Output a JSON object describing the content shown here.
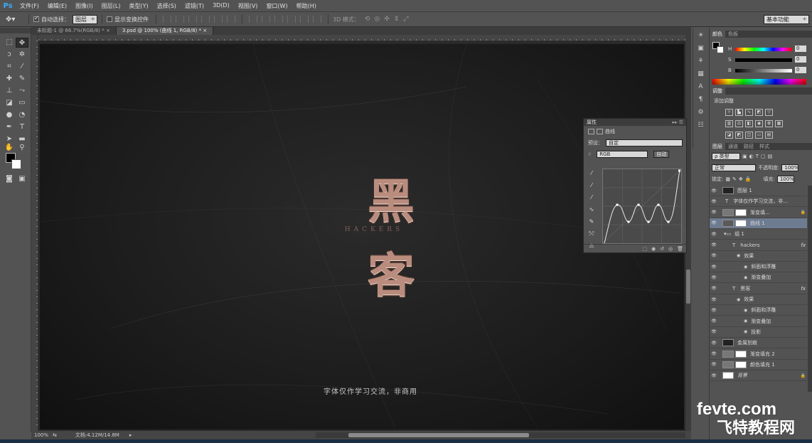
{
  "app": {
    "logo": "Ps"
  },
  "menu": [
    "文件(F)",
    "编辑(E)",
    "图像(I)",
    "图层(L)",
    "类型(Y)",
    "选择(S)",
    "滤镜(T)",
    "3D(D)",
    "视图(V)",
    "窗口(W)",
    "帮助(H)"
  ],
  "options_bar": {
    "auto_select_label": "自动选择：",
    "auto_select_value": "图层",
    "show_transform_label": "显示变换控件",
    "mode_3d_label": "3D 模式：",
    "workspace": "基本功能"
  },
  "doc_tabs": [
    {
      "label": "未标题-1 @ 66.7%(RGB/8) *",
      "active": false
    },
    {
      "label": "3.psd @ 100% (曲线 1, RGB/8) *",
      "active": true
    }
  ],
  "artwork": {
    "char1": "黑",
    "subtitle": "HACKERS",
    "char2": "客",
    "caption": "字体仅作学习交流，非商用"
  },
  "status_bar": {
    "zoom": "100%",
    "doc_size": "文档:4.12M/14.8M"
  },
  "properties": {
    "title": "属性",
    "header": "曲线",
    "preset_label": "预设：",
    "preset_value": "自定",
    "channel": "RGB",
    "auto_label": "自动"
  },
  "color_panel": {
    "tabs": [
      "颜色",
      "色板"
    ],
    "channels": [
      {
        "label": "H",
        "value": "0"
      },
      {
        "label": "S",
        "value": "0"
      },
      {
        "label": "B",
        "value": "0"
      }
    ]
  },
  "adjustments": {
    "tabs": [
      "调整"
    ],
    "add_label": "添加调整"
  },
  "layers_panel": {
    "tabs": [
      "图层",
      "通道",
      "路径",
      "样式"
    ],
    "kind_filter": "ρ 类型",
    "blend_mode": "正常",
    "opacity_label": "不透明度:",
    "opacity_value": "100%",
    "lock_label": "锁定:",
    "fill_label": "填充:",
    "fill_value": "100%",
    "layers": [
      {
        "name": "图层 1",
        "indent": 0,
        "kind": "pixel"
      },
      {
        "name": "字体仅作学习交流，非...",
        "indent": 0,
        "kind": "text"
      },
      {
        "name": "渐变填...",
        "indent": 0,
        "kind": "fill",
        "locked": true
      },
      {
        "name": "曲线 1",
        "indent": 0,
        "kind": "adjust",
        "selected": true
      },
      {
        "name": "组 1",
        "indent": 0,
        "kind": "group"
      },
      {
        "name": "hackers",
        "indent": 1,
        "kind": "text",
        "fx": true
      },
      {
        "name": "效果",
        "indent": 2,
        "kind": "effect"
      },
      {
        "name": "斜面和浮雕",
        "indent": 3,
        "kind": "effect"
      },
      {
        "name": "渐变叠加",
        "indent": 3,
        "kind": "effect"
      },
      {
        "name": "黑客",
        "indent": 1,
        "kind": "text",
        "fx": true
      },
      {
        "name": "效果",
        "indent": 2,
        "kind": "effect"
      },
      {
        "name": "斜面和浮雕",
        "indent": 3,
        "kind": "effect"
      },
      {
        "name": "渐变叠加",
        "indent": 3,
        "kind": "effect"
      },
      {
        "name": "投影",
        "indent": 3,
        "kind": "effect"
      },
      {
        "name": "金属划痕",
        "indent": 0,
        "kind": "pixel"
      },
      {
        "name": "渐变填充 2",
        "indent": 0,
        "kind": "fill"
      },
      {
        "name": "颜色填充 1",
        "indent": 0,
        "kind": "fill"
      },
      {
        "name": "背景",
        "indent": 0,
        "kind": "background",
        "locked": true
      }
    ]
  },
  "watermark": {
    "url": "fevte.com",
    "name": "飞特教程网"
  }
}
